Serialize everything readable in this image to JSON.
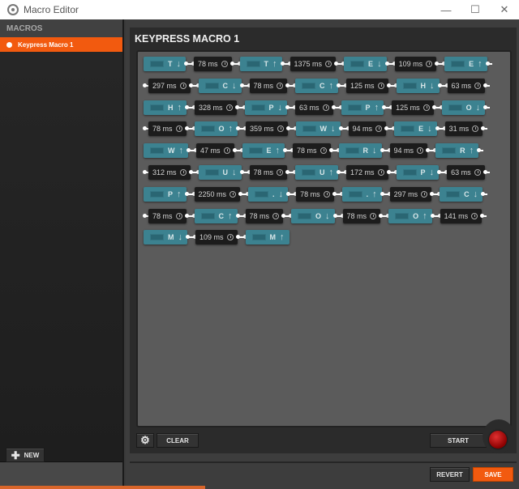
{
  "window": {
    "title": "Macro Editor",
    "controls": {
      "minimize": "—",
      "maximize": "☐",
      "close": "✕"
    }
  },
  "sidebar": {
    "header": "MACROS",
    "items": [
      {
        "label": "Keypress Macro 1",
        "selected": true
      }
    ],
    "new_button": "NEW"
  },
  "editor": {
    "title": "KEYPRESS MACRO 1",
    "rows": [
      [
        {
          "t": "key",
          "k": "T",
          "d": "down"
        },
        {
          "t": "delay",
          "v": "78 ms"
        },
        {
          "t": "key",
          "k": "T",
          "d": "up"
        },
        {
          "t": "delay",
          "v": "1375 ms"
        },
        {
          "t": "key",
          "k": "E",
          "d": "down"
        },
        {
          "t": "delay",
          "v": "109 ms"
        },
        {
          "t": "key",
          "k": "E",
          "d": "up"
        }
      ],
      [
        {
          "t": "delay",
          "v": "297 ms"
        },
        {
          "t": "key",
          "k": "C",
          "d": "down"
        },
        {
          "t": "delay",
          "v": "78 ms"
        },
        {
          "t": "key",
          "k": "C",
          "d": "up"
        },
        {
          "t": "delay",
          "v": "125 ms"
        },
        {
          "t": "key",
          "k": "H",
          "d": "down"
        },
        {
          "t": "delay",
          "v": "63 ms"
        }
      ],
      [
        {
          "t": "key",
          "k": "H",
          "d": "up"
        },
        {
          "t": "delay",
          "v": "328 ms"
        },
        {
          "t": "key",
          "k": "P",
          "d": "down"
        },
        {
          "t": "delay",
          "v": "63 ms"
        },
        {
          "t": "key",
          "k": "P",
          "d": "up"
        },
        {
          "t": "delay",
          "v": "125 ms"
        },
        {
          "t": "key",
          "k": "O",
          "d": "down"
        }
      ],
      [
        {
          "t": "delay",
          "v": "78 ms"
        },
        {
          "t": "key",
          "k": "O",
          "d": "up"
        },
        {
          "t": "delay",
          "v": "359 ms"
        },
        {
          "t": "key",
          "k": "W",
          "d": "down"
        },
        {
          "t": "delay",
          "v": "94 ms"
        },
        {
          "t": "key",
          "k": "E",
          "d": "down"
        },
        {
          "t": "delay",
          "v": "31 ms"
        }
      ],
      [
        {
          "t": "key",
          "k": "W",
          "d": "up"
        },
        {
          "t": "delay",
          "v": "47 ms"
        },
        {
          "t": "key",
          "k": "E",
          "d": "up"
        },
        {
          "t": "delay",
          "v": "78 ms"
        },
        {
          "t": "key",
          "k": "R",
          "d": "down"
        },
        {
          "t": "delay",
          "v": "94 ms"
        },
        {
          "t": "key",
          "k": "R",
          "d": "up"
        }
      ],
      [
        {
          "t": "delay",
          "v": "312 ms"
        },
        {
          "t": "key",
          "k": "U",
          "d": "down"
        },
        {
          "t": "delay",
          "v": "78 ms"
        },
        {
          "t": "key",
          "k": "U",
          "d": "up"
        },
        {
          "t": "delay",
          "v": "172 ms"
        },
        {
          "t": "key",
          "k": "P",
          "d": "down"
        },
        {
          "t": "delay",
          "v": "63 ms"
        }
      ],
      [
        {
          "t": "key",
          "k": "P",
          "d": "up"
        },
        {
          "t": "delay",
          "v": "2250 ms"
        },
        {
          "t": "key",
          "k": ".",
          "d": "down"
        },
        {
          "t": "delay",
          "v": "78 ms"
        },
        {
          "t": "key",
          "k": ".",
          "d": "up"
        },
        {
          "t": "delay",
          "v": "297 ms"
        },
        {
          "t": "key",
          "k": "C",
          "d": "down"
        }
      ],
      [
        {
          "t": "delay",
          "v": "78 ms"
        },
        {
          "t": "key",
          "k": "C",
          "d": "up"
        },
        {
          "t": "delay",
          "v": "78 ms"
        },
        {
          "t": "key",
          "k": "O",
          "d": "down"
        },
        {
          "t": "delay",
          "v": "78 ms"
        },
        {
          "t": "key",
          "k": "O",
          "d": "up"
        },
        {
          "t": "delay",
          "v": "141 ms"
        }
      ],
      [
        {
          "t": "key",
          "k": "M",
          "d": "down"
        },
        {
          "t": "delay",
          "v": "109 ms"
        },
        {
          "t": "key",
          "k": "M",
          "d": "up"
        }
      ]
    ],
    "clear_button": "CLEAR",
    "start_button": "START"
  },
  "footer": {
    "revert_button": "REVERT",
    "save_button": "SAVE"
  },
  "colors": {
    "accent": "#f25a0f",
    "key_node": "#3c8290",
    "delay_node": "#1c1c1c",
    "record": "#c01818"
  }
}
